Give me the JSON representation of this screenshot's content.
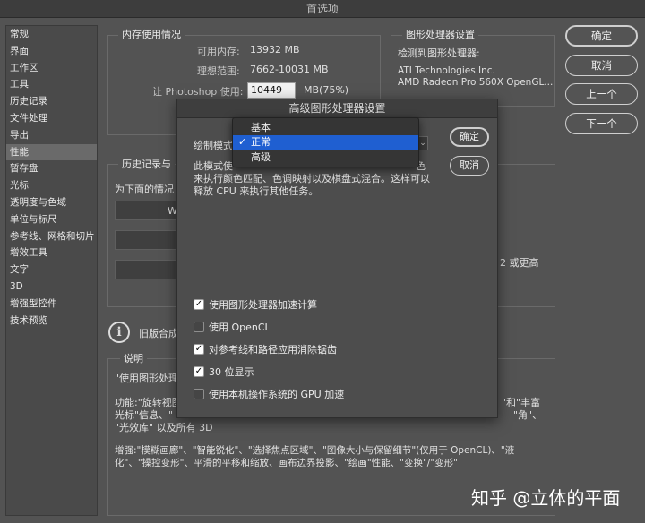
{
  "window": {
    "title": "首选项"
  },
  "sidebar": {
    "items": [
      {
        "label": "常规"
      },
      {
        "label": "界面"
      },
      {
        "label": "工作区"
      },
      {
        "label": "工具"
      },
      {
        "label": "历史记录"
      },
      {
        "label": "文件处理"
      },
      {
        "label": "导出"
      },
      {
        "label": "性能"
      },
      {
        "label": "暂存盘"
      },
      {
        "label": "光标"
      },
      {
        "label": "透明度与色域"
      },
      {
        "label": "单位与标尺"
      },
      {
        "label": "参考线、网格和切片"
      },
      {
        "label": "增效工具"
      },
      {
        "label": "文字"
      },
      {
        "label": "3D"
      },
      {
        "label": "增强型控件"
      },
      {
        "label": "技术预览"
      }
    ],
    "selected": "性能"
  },
  "buttons": {
    "ok": "确定",
    "cancel": "取消",
    "prev": "上一个",
    "next": "下一个"
  },
  "memory": {
    "title": "内存使用情况",
    "available_label": "可用内存:",
    "available_value": "13932 MB",
    "ideal_label": "理想范围:",
    "ideal_value": "7662-10031 MB",
    "let_label": "让 Photoshop 使用:",
    "let_value": "10449",
    "let_unit": "MB(75%)",
    "slider_minus": "–"
  },
  "gpu": {
    "title": "图形处理器设置",
    "detected_label": "检测到图形处理器:",
    "vendor": "ATI Technologies Inc.",
    "model": "AMD Radeon Pro 560X OpenGL..."
  },
  "history": {
    "title_partial": "历史记录与",
    "desc_partial": "为下面的情况",
    "field_partial": "W"
  },
  "right_partial": {
    "text": "2 或更高"
  },
  "legacy": {
    "text_partial": "旧版合成"
  },
  "description": {
    "title": "说明",
    "line1": "\"使用图形处理",
    "line2a": "功能:\"旋转视图",
    "line2b": "\"和\"丰富",
    "line3a": "光标\"信息、\"",
    "line3b": "\"角\"、",
    "line4": "\"光效库\" 以及所有 3D",
    "line5": "增强:\"模糊画廊\"、\"智能锐化\"、\"选择焦点区域\"、\"图像大小与保留细节\"(仅用于 OpenCL)、\"液",
    "line6": "化\"、\"操控变形\"、平滑的平移和缩放、画布边界投影、\"绘画\"性能、\"变换\"/\"变形\""
  },
  "dialog": {
    "title": "高级图形处理器设置",
    "mode_label_partial": "绘制模式",
    "ok": "确定",
    "cancel": "取消",
    "desc_line1a": "此模式使",
    "desc_line1b": "色",
    "desc_line2": "来执行颜色匹配、色调映射以及棋盘式混合。这样可以",
    "desc_line3": "释放 CPU 来执行其他任务。",
    "options": [
      {
        "label": "使用图形处理器加速计算",
        "checked": true
      },
      {
        "label": "使用 OpenCL",
        "checked": false
      },
      {
        "label": "对参考线和路径应用消除锯齿",
        "checked": true
      },
      {
        "label": "30 位显示",
        "checked": true
      },
      {
        "label": "使用本机操作系统的 GPU 加速",
        "checked": false
      }
    ],
    "dropdown": {
      "items": [
        {
          "label": "基本"
        },
        {
          "label": "正常"
        },
        {
          "label": "高级"
        }
      ],
      "selected": "正常",
      "check_glyph": "✓"
    }
  },
  "watermark": {
    "text": "知乎 @立体的平面"
  }
}
